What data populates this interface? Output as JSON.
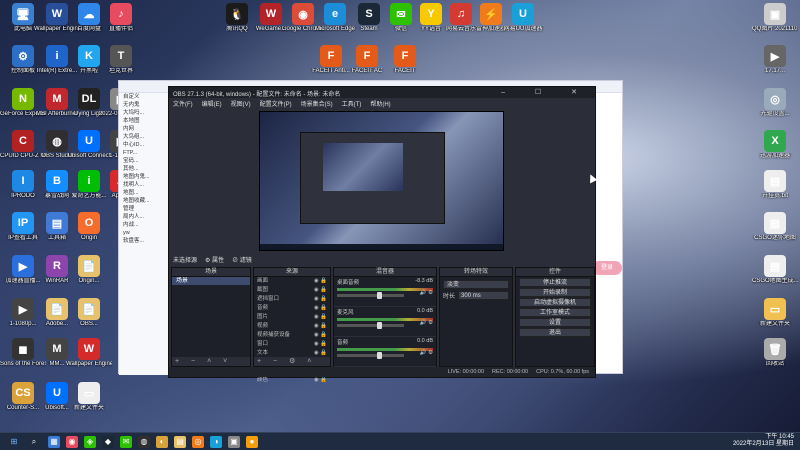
{
  "desktop_icons": [
    {
      "label": "此电脑",
      "glyph": "🖥",
      "color": "#3b7fd1"
    },
    {
      "label": "Wallpaper Engine:...",
      "glyph": "W",
      "color": "#2a4f9a"
    },
    {
      "label": "百度网盘",
      "glyph": "☁",
      "color": "#2f86e8"
    },
    {
      "label": "直播伴侣",
      "glyph": "♪",
      "color": "#e84a5f"
    },
    {
      "label": "腾讯QQ",
      "glyph": "🐧",
      "color": "#1b1b1b"
    },
    {
      "label": "WeGame...",
      "glyph": "W",
      "color": "#b3242a"
    },
    {
      "label": "Google Chrome",
      "glyph": "◉",
      "color": "#dd4b39"
    },
    {
      "label": "Microsoft Edge",
      "glyph": "e",
      "color": "#1c8dd8"
    },
    {
      "label": "Steam",
      "glyph": "S",
      "color": "#1b2838"
    },
    {
      "label": "微信",
      "glyph": "✉",
      "color": "#2dc100"
    },
    {
      "label": "YY语音",
      "glyph": "Y",
      "color": "#f7c900"
    },
    {
      "label": "网易云音乐",
      "glyph": "♫",
      "color": "#d33a31"
    },
    {
      "label": "雷神加速器",
      "glyph": "⚡",
      "color": "#f07b1a"
    },
    {
      "label": "网易UU加速器",
      "glyph": "U",
      "color": "#1aa0d8"
    },
    {
      "label": "控制面板",
      "glyph": "⚙",
      "color": "#2d6fc4"
    },
    {
      "label": "Intel(R) Extre...",
      "glyph": "i",
      "color": "#1f64c8"
    },
    {
      "label": "开黑啦",
      "glyph": "K",
      "color": "#22a6f0"
    },
    {
      "label": "坦克世界",
      "glyph": "T",
      "color": "#555"
    },
    {
      "label": "FACEIT Anti...",
      "glyph": "F",
      "color": "#e45a18"
    },
    {
      "label": "FACEIT AC",
      "glyph": "F",
      "color": "#e45a18"
    },
    {
      "label": "FACEIT",
      "glyph": "F",
      "color": "#e45a18"
    },
    {
      "label": "GeForce Experience",
      "glyph": "N",
      "color": "#76b900"
    },
    {
      "label": "MSI Afterburner",
      "glyph": "M",
      "color": "#c1272d"
    },
    {
      "label": "Dying Light",
      "glyph": "DL",
      "color": "#222"
    },
    {
      "label": "2022-02-17-40...",
      "glyph": "▶",
      "color": "#888"
    },
    {
      "label": "CPUID CPU-Z MSI",
      "glyph": "C",
      "color": "#b22222"
    },
    {
      "label": "OBS Studio",
      "glyph": "◍",
      "color": "#302e31"
    },
    {
      "label": "Ubisoft Connect",
      "glyph": "U",
      "color": "#0070ff"
    },
    {
      "label": "1-1080...",
      "glyph": "▶",
      "color": "#444"
    },
    {
      "label": "IPRODO",
      "glyph": "I",
      "color": "#1e88e5"
    },
    {
      "label": "暴雪战网",
      "glyph": "B",
      "color": "#148eff"
    },
    {
      "label": "爱奇艺万能...",
      "glyph": "i",
      "color": "#00be06"
    },
    {
      "label": "Apex...",
      "glyph": "A",
      "color": "#da292a"
    },
    {
      "label": "IP查看工具",
      "glyph": "IP",
      "color": "#2196f3"
    },
    {
      "label": "工具箱",
      "glyph": "▤",
      "color": "#3f7ad6"
    },
    {
      "label": "Origin",
      "glyph": "O",
      "color": "#f56c2d"
    },
    {
      "label": "加速器直播...",
      "glyph": "▶",
      "color": "#2a6fdb"
    },
    {
      "label": "WinRAR",
      "glyph": "R",
      "color": "#8e44ad"
    },
    {
      "label": "Origin...",
      "glyph": "📄",
      "color": "#e8c26b"
    },
    {
      "label": "1-1080p...",
      "glyph": "▶",
      "color": "#444"
    },
    {
      "label": "Adobe...",
      "glyph": "📄",
      "color": "#e8c26b"
    },
    {
      "label": "OBS...",
      "glyph": "📄",
      "color": "#e8c26b"
    },
    {
      "label": "Sons of the Forest",
      "glyph": "◼",
      "color": "#333"
    },
    {
      "label": "MM...",
      "glyph": "M",
      "color": "#444"
    },
    {
      "label": "Wallpaper Engine",
      "glyph": "W",
      "color": "#d42a2a"
    },
    {
      "label": "Counter-S...",
      "glyph": "CS",
      "color": "#d9a23a"
    },
    {
      "label": "Ubisoft...",
      "glyph": "U",
      "color": "#0070ff"
    },
    {
      "label": "新建文件夹",
      "glyph": "▭",
      "color": "#eee"
    },
    {
      "label": "QQ图片 20211102...",
      "glyph": "▣",
      "color": "#ccc"
    },
    {
      "label": "17.17...",
      "glyph": "▶",
      "color": "#666"
    },
    {
      "label": "光驱设置...",
      "glyph": "◎",
      "color": "#9ab"
    },
    {
      "label": "迅游加速器",
      "glyph": "X",
      "color": "#2fa84f"
    },
    {
      "label": "开挂员.txt",
      "glyph": "▤",
      "color": "#eee"
    },
    {
      "label": "CSGO迷你地图",
      "glyph": "▤",
      "color": "#eee"
    },
    {
      "label": "CSGO地图生成...",
      "glyph": "▤",
      "color": "#eee"
    },
    {
      "label": "新建文件夹",
      "glyph": "▭",
      "color": "#f0c050"
    },
    {
      "label": "回收站",
      "glyph": "🗑",
      "color": "#aaa"
    }
  ],
  "browser": {
    "qq_items": [
      "自定义",
      "无内鬼",
      "大坞吗...",
      "本地图",
      "内网",
      "大鸟组...",
      "中心ID...",
      "FTP...",
      "宝码...",
      "其他...",
      "地图内鬼...",
      "找明人...",
      "地图...",
      "地图收藏...",
      "管理",
      "局内人...",
      "内战...",
      "yw",
      "软盘客..."
    ],
    "pink_btn": "登录"
  },
  "obs": {
    "title": "OBS 27.1.3 (64-bit, windows) - 配置文件: 未命名 - 场景: 未命名",
    "window_controls": "– ☐ ✕",
    "menu": [
      "文件(F)",
      "编辑(E)",
      "视图(V)",
      "配置文件(P)",
      "场景集合(S)",
      "工具(T)",
      "帮助(H)"
    ],
    "scene_row": {
      "selected": "未选择源",
      "props": "⚙ 属性",
      "filters": "⊘ 滤镜"
    },
    "docks": {
      "scenes": {
        "title": "场景",
        "items": [
          "场景"
        ]
      },
      "sources": {
        "title": "来源",
        "items": [
          "画面",
          "截图",
          "遮挡窗口",
          "音频",
          "图片",
          "视频",
          "视频捕获设备",
          "窗口",
          "文本",
          "游戏",
          "媒体",
          "颜色"
        ]
      },
      "mixer": {
        "title": "混音器",
        "channels": [
          {
            "name": "桌面音频",
            "db": "-8.3 dB"
          },
          {
            "name": "麦克风",
            "db": "0.0 dB"
          },
          {
            "name": "音频",
            "db": "0.0 dB"
          }
        ]
      },
      "transitions": {
        "title": "转场特效",
        "type": "淡变",
        "duration_label": "时长",
        "duration": "300 ms"
      },
      "controls": {
        "title": "控件",
        "buttons": [
          "停止推流",
          "开始录制",
          "启动虚拟摄像机",
          "工作室模式",
          "设置",
          "退出"
        ]
      }
    },
    "status": {
      "live": "LIVE: 00:00:00",
      "rec": "REC: 00:00:00",
      "cpu": "CPU: 0.7%, 60.00 fps"
    }
  },
  "taskbar": {
    "start": "⊞",
    "search": "⌕",
    "pinned": [
      "▦",
      "◉",
      "◈",
      "◆",
      "✉",
      "◍",
      "◐",
      "▤",
      "◎",
      "◑",
      "▣",
      "●"
    ],
    "time": "下午 10:45",
    "date": "2022年2月13日 星期日"
  }
}
